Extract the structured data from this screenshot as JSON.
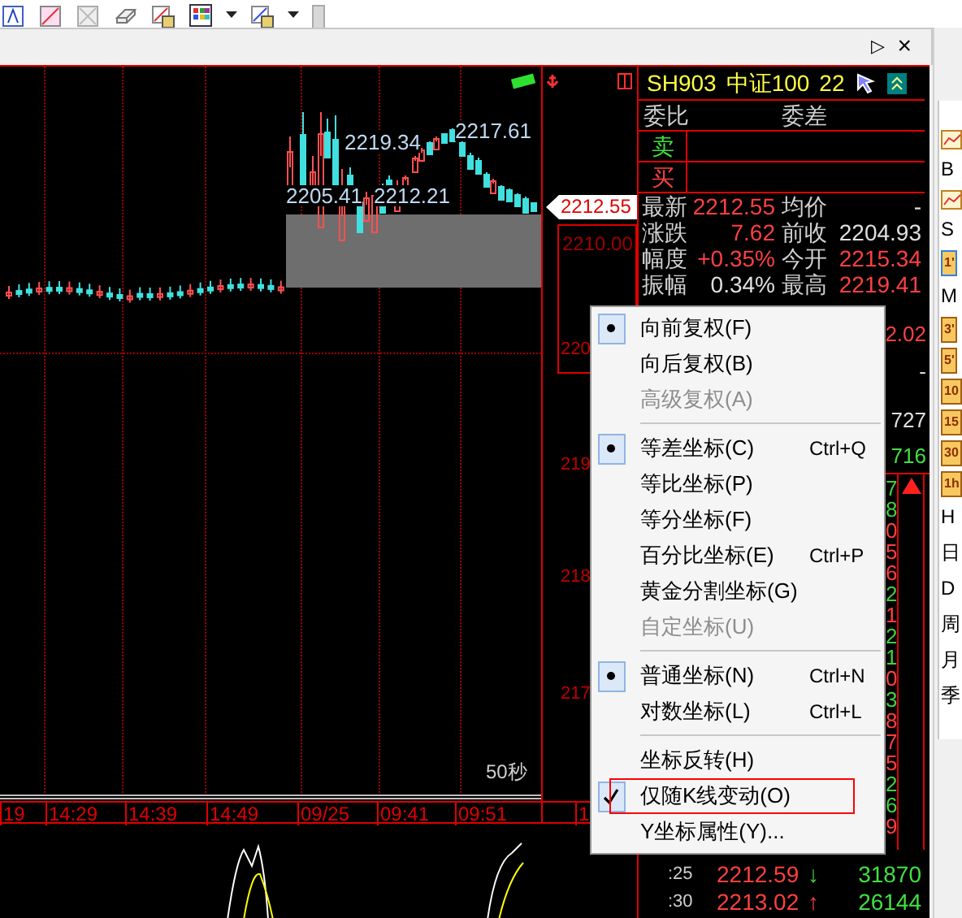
{
  "panel_header": {
    "play": "▷",
    "close": "×"
  },
  "chart": {
    "price_labels": [
      "2219.34",
      "2217.61",
      "2205.41",
      "2212.21"
    ],
    "current_price": "2212.55",
    "range_label": "2210.00",
    "y_axis_labels": [
      "220",
      "219",
      "218",
      "217"
    ],
    "interval": "50秒",
    "time_labels": [
      "19",
      "14:29",
      "14:39",
      "14:49",
      "09/25",
      "09:41",
      "09:51",
      "1"
    ]
  },
  "quote": {
    "code": "SH903",
    "name": "中证100",
    "number": "22",
    "order_ratio": "委比",
    "order_diff": "委差",
    "sell": "卖",
    "buy": "买",
    "stats": [
      {
        "label": "最新",
        "value": "2212.55",
        "color": "#ff4040"
      },
      {
        "label": "均价",
        "value": "-",
        "color": "#e0e0e0"
      },
      {
        "label": "涨跌",
        "value": "7.62",
        "color": "#ff4040"
      },
      {
        "label": "前收",
        "value": "2204.93",
        "color": "#e0e0e0"
      },
      {
        "label": "幅度",
        "value": "+0.35%",
        "color": "#ff4040"
      },
      {
        "label": "今开",
        "value": "2215.34",
        "color": "#ff4040"
      },
      {
        "label": "振幅",
        "value": "0.34%",
        "color": "#e0e0e0"
      },
      {
        "label": "最高",
        "value": "2219.41",
        "color": "#ff4040"
      }
    ],
    "partial_values": [
      {
        "text": "2.02",
        "color": "#ff4040"
      },
      {
        "text": "-",
        "color": "#e0e0e0"
      },
      {
        "text": "727",
        "color": "#e0e0e0"
      },
      {
        "text": "716",
        "color": "#40e040"
      }
    ],
    "tick_digits": [
      {
        "text": "7",
        "color": "#40d040"
      },
      {
        "text": "8",
        "color": "#40d040"
      },
      {
        "text": "0",
        "color": "#ff4040"
      },
      {
        "text": "5",
        "color": "#ff4040"
      },
      {
        "text": "6",
        "color": "#ff4040"
      },
      {
        "text": "2",
        "color": "#40d040"
      },
      {
        "text": "1",
        "color": "#ff4040"
      },
      {
        "text": "2",
        "color": "#40d040"
      },
      {
        "text": "1",
        "color": "#40d040"
      },
      {
        "text": "0",
        "color": "#ff4040"
      },
      {
        "text": "3",
        "color": "#40d040"
      },
      {
        "text": "8",
        "color": "#ff4040"
      },
      {
        "text": "7",
        "color": "#ff4040"
      },
      {
        "text": "5",
        "color": "#ff4040"
      },
      {
        "text": "2",
        "color": "#40d040"
      },
      {
        "text": "6",
        "color": "#40d040"
      },
      {
        "text": "9",
        "color": "#ff4040"
      }
    ],
    "trades": [
      {
        "time": ":25",
        "price": "2212.59",
        "arrow": "↓",
        "color": "#40d040",
        "volume": "31870"
      },
      {
        "time": ":30",
        "price": "2213.02",
        "arrow": "↑",
        "color": "#ff4040",
        "volume": "26144"
      }
    ]
  },
  "context_menu": {
    "sections": [
      {
        "items": [
          {
            "kind": "radio",
            "label": "向前复权(F)",
            "selected": true,
            "disabled": false
          },
          {
            "kind": "radio",
            "label": "向后复权(B)",
            "selected": false,
            "disabled": false
          },
          {
            "kind": "radio",
            "label": "高级复权(A)",
            "selected": false,
            "disabled": true
          }
        ]
      },
      {
        "items": [
          {
            "kind": "radio",
            "label": "等差坐标(C)",
            "shortcut": "Ctrl+Q",
            "selected": true,
            "disabled": false
          },
          {
            "kind": "radio",
            "label": "等比坐标(P)",
            "selected": false,
            "disabled": false
          },
          {
            "kind": "radio",
            "label": "等分坐标(F)",
            "selected": false,
            "disabled": false
          },
          {
            "kind": "radio",
            "label": "百分比坐标(E)",
            "shortcut": "Ctrl+P",
            "selected": false,
            "disabled": false
          },
          {
            "kind": "radio",
            "label": "黄金分割坐标(G)",
            "selected": false,
            "disabled": false
          },
          {
            "kind": "radio",
            "label": "自定坐标(U)",
            "selected": false,
            "disabled": true
          }
        ]
      },
      {
        "items": [
          {
            "kind": "radio",
            "label": "普通坐标(N)",
            "shortcut": "Ctrl+N",
            "selected": true,
            "disabled": false
          },
          {
            "kind": "radio",
            "label": "对数坐标(L)",
            "shortcut": "Ctrl+L",
            "selected": false,
            "disabled": false
          }
        ]
      },
      {
        "items": [
          {
            "kind": "check",
            "label": "坐标反转(H)",
            "selected": false,
            "disabled": false,
            "highlighted": false
          },
          {
            "kind": "check",
            "label": "仅随K线变动(O)",
            "selected": true,
            "disabled": false,
            "highlighted": true
          },
          {
            "kind": "command",
            "label": "Y坐标属性(Y)...",
            "disabled": false,
            "highlighted": false
          }
        ]
      }
    ]
  },
  "sidebar": {
    "items": [
      {
        "kind": "icon",
        "selected": false
      },
      {
        "kind": "text",
        "label": "B",
        "selected": false
      },
      {
        "kind": "icon",
        "selected": false
      },
      {
        "kind": "text",
        "label": "S",
        "selected": false
      },
      {
        "kind": "badge",
        "label": "1'",
        "selected": true
      },
      {
        "kind": "text",
        "label": "M",
        "selected": false
      },
      {
        "kind": "badge",
        "label": "3'",
        "selected": false
      },
      {
        "kind": "badge",
        "label": "5'",
        "selected": false
      },
      {
        "kind": "badge",
        "label": "10",
        "selected": false
      },
      {
        "kind": "badge",
        "label": "15",
        "selected": false
      },
      {
        "kind": "badge",
        "label": "30",
        "selected": false
      },
      {
        "kind": "badge",
        "label": "1h",
        "selected": false
      },
      {
        "kind": "text",
        "label": "H",
        "selected": false
      },
      {
        "kind": "text",
        "label": "日",
        "selected": false
      },
      {
        "kind": "text",
        "label": "D",
        "selected": false
      },
      {
        "kind": "text",
        "label": "周",
        "selected": false
      },
      {
        "kind": "text",
        "label": "月",
        "selected": false
      },
      {
        "kind": "text",
        "label": "季",
        "selected": false
      }
    ]
  }
}
